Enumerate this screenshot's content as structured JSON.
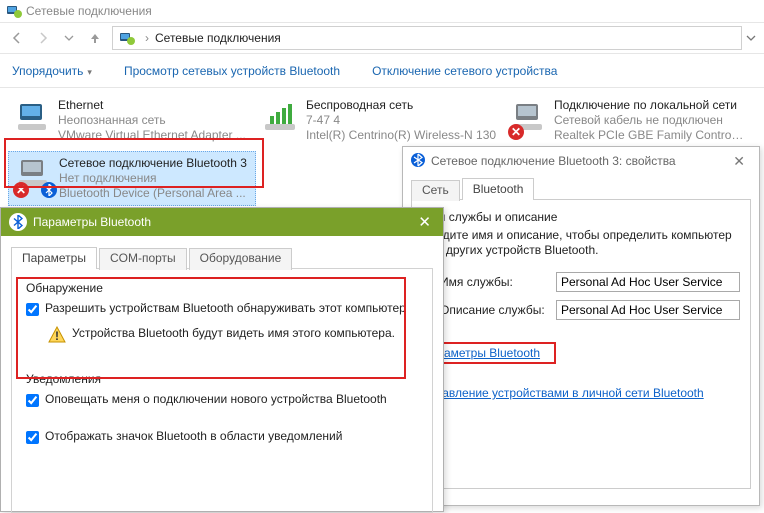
{
  "window": {
    "title": "Сетевые подключения",
    "breadcrumb_root": "Сетевые подключения"
  },
  "toolbar": {
    "organize": "Упорядочить",
    "view_bt_devices": "Просмотр сетевых устройств Bluetooth",
    "disable_device": "Отключение сетевого устройства"
  },
  "connections": [
    {
      "name": "Ethernet",
      "status": "Неопознанная сеть",
      "dev": "VMware Virtual Ethernet Adapter ...",
      "kind": "eth"
    },
    {
      "name": "Беспроводная сеть",
      "status": "7-47  4",
      "dev": "Intel(R) Centrino(R) Wireless-N 130",
      "kind": "wifi"
    },
    {
      "name": "Подключение по локальной сети",
      "status": "Сетевой кабель не подключен",
      "dev": "Realtek PCIe GBE Family Controller",
      "kind": "eth",
      "disabled": true
    },
    {
      "name": "Сетевое подключение Bluetooth 3",
      "status": "Нет подключения",
      "dev": "Bluetooth Device (Personal Area ...",
      "kind": "bt",
      "disabled": true,
      "selected": true
    }
  ],
  "props": {
    "title": "Сетевое подключение Bluetooth 3: свойства",
    "tabs": {
      "net": "Сеть",
      "bt": "Bluetooth"
    },
    "service_section": "Имя службы и описание",
    "service_desc": "Введите имя и описание, чтобы определить компьютер для других устройств Bluetooth.",
    "service_name_label": "Имя службы:",
    "service_name_value": "Personal Ad Hoc User Service",
    "service_desc_label": "Описание службы:",
    "service_desc_value": "Personal Ad Hoc User Service",
    "link_params": "Параметры Bluetooth",
    "link_manage": "Управление устройствами в личной сети Bluetooth"
  },
  "btparams": {
    "title": "Параметры Bluetooth",
    "tabs": {
      "params": "Параметры",
      "com": "COM-порты",
      "hw": "Оборудование"
    },
    "grp_discovery": "Обнаружение",
    "chk_allow_discover": "Разрешить устройствам Bluetooth обнаруживать этот компьютер",
    "warn_discover": "Устройства Bluetooth будут видеть имя этого компьютера.",
    "grp_notify": "Уведомления",
    "chk_notify": "Оповещать меня о подключении нового устройства Bluetooth",
    "chk_trayicon": "Отображать значок Bluetooth в области уведомлений"
  }
}
